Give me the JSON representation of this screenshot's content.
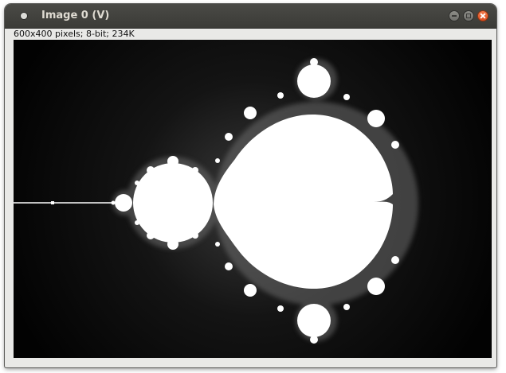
{
  "window": {
    "title": "Image 0 (V)",
    "info_line": "600x400 pixels; 8-bit; 234K",
    "controls": {
      "minimize_icon": "minimize-icon",
      "maximize_icon": "maximize-icon",
      "close_icon": "close-icon"
    }
  },
  "image": {
    "content": "Mandelbrot set fractal",
    "colors": {
      "set_fill": "#ffffff",
      "background": "#020202",
      "close_button": "#e8602e"
    }
  }
}
